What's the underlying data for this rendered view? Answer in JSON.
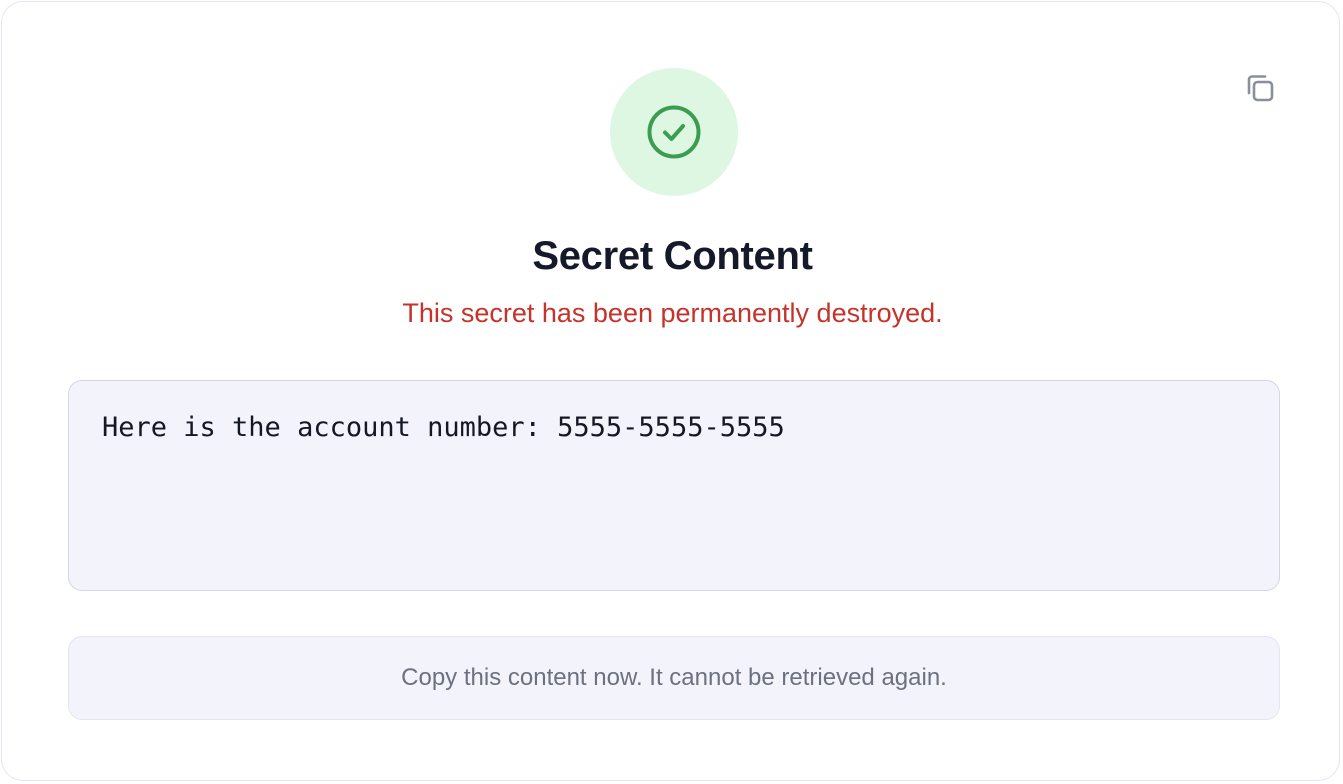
{
  "header": {
    "status_icon": "check-circle-icon",
    "title": "Secret Content",
    "subtitle": "This secret has been permanently destroyed."
  },
  "toolbar": {
    "copy_icon": "copy-icon"
  },
  "secret": {
    "content": "Here is the account number: 5555-5555-5555"
  },
  "notice": {
    "text": "Copy this content now. It cannot be retrieved again."
  },
  "colors": {
    "success_green": "#3a9d4f",
    "success_bg": "#ddf7e2",
    "danger_red": "#c5332b",
    "text_dark": "#151a2b",
    "muted_gray": "#6c7180"
  }
}
